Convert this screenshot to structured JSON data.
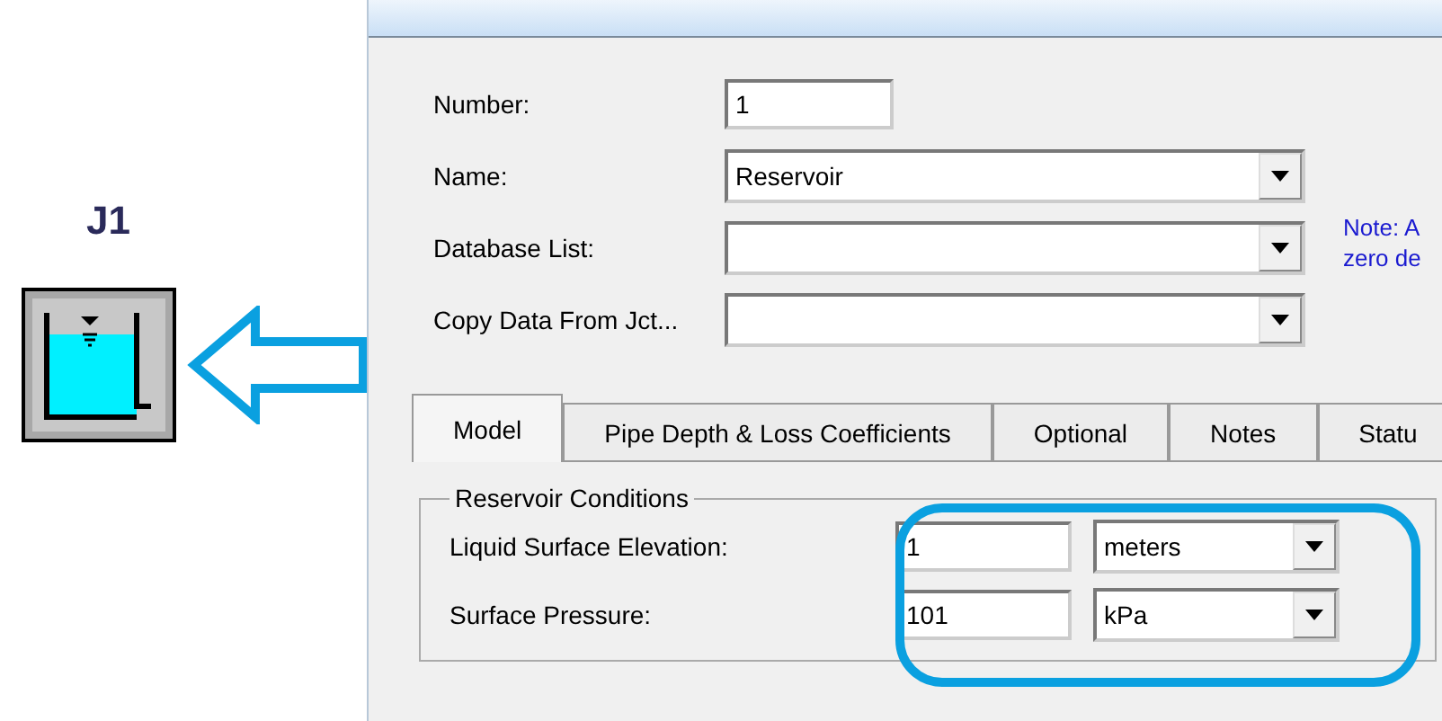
{
  "junction": {
    "label": "J1"
  },
  "form": {
    "fields": [
      {
        "label": "Number:",
        "kind": "text",
        "value": "1"
      },
      {
        "label": "Name:",
        "kind": "combo",
        "value": "Reservoir"
      },
      {
        "label": "Database List:",
        "kind": "combo"
      },
      {
        "label": "Copy Data From Jct...",
        "kind": "combo"
      }
    ],
    "note": [
      "Note: A",
      "zero de"
    ]
  },
  "tabs": [
    {
      "label": "Model",
      "selected": true
    },
    {
      "label": "Pipe Depth & Loss Coefficients",
      "selected": false
    },
    {
      "label": "Optional",
      "selected": false
    },
    {
      "label": "Notes",
      "selected": false
    },
    {
      "label": "Statu",
      "selected": false
    }
  ],
  "group": {
    "title": "Reservoir Conditions",
    "rows": [
      {
        "label": "Liquid Surface Elevation:",
        "value": "1",
        "unit": "meters"
      },
      {
        "label": "Surface Pressure:",
        "value": "101",
        "unit": "kPa"
      }
    ]
  }
}
